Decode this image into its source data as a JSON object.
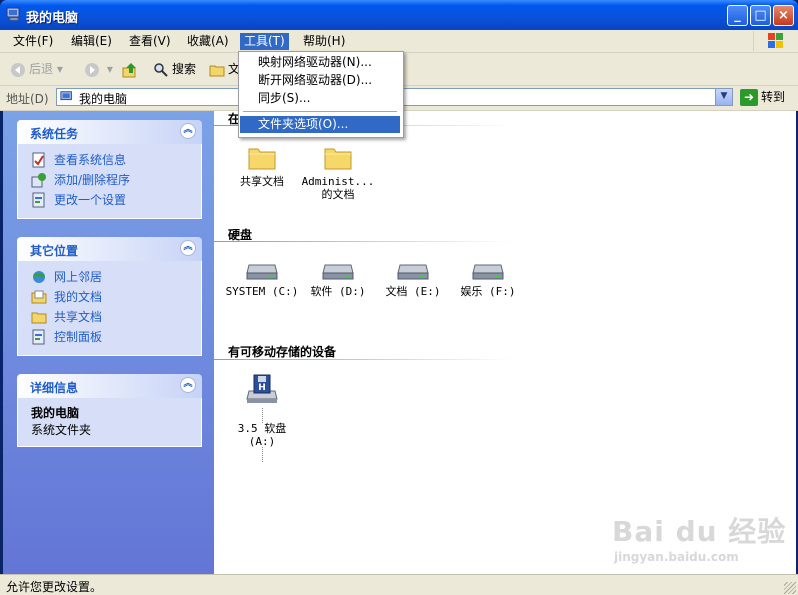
{
  "window": {
    "title": "我的电脑"
  },
  "menubar": {
    "items": [
      "文件(F)",
      "编辑(E)",
      "查看(V)",
      "收藏(A)",
      "工具(T)",
      "帮助(H)"
    ]
  },
  "toolbar": {
    "back_label": "后退",
    "search_label": "搜索",
    "folders_label": "文"
  },
  "address": {
    "label": "地址(D)",
    "value": "我的电脑",
    "go_label": "转到"
  },
  "tasks": {
    "title": "系统任务",
    "items": [
      "查看系统信息",
      "添加/删除程序",
      "更改一个设置"
    ]
  },
  "places": {
    "title": "其它位置",
    "items": [
      "网上邻居",
      "我的文档",
      "共享文档",
      "控制面板"
    ]
  },
  "details": {
    "title": "详细信息",
    "name": "我的电脑",
    "subtitle": "系统文件夹"
  },
  "groups": {
    "files_partial": "在",
    "drives": "硬盘",
    "removable": "有可移动存储的设备"
  },
  "folders": [
    {
      "label1": "共享文档",
      "label2": ""
    },
    {
      "label1": "Administ...",
      "label2": "的文档"
    }
  ],
  "drives": [
    "SYSTEM (C:)",
    "软件 (D:)",
    "文档 (E:)",
    "娱乐 (F:)"
  ],
  "removable": [
    {
      "label1": "3.5 软盘",
      "label2": "(A:)"
    }
  ],
  "tools_menu": {
    "items": [
      "映射网络驱动器(N)...",
      "断开网络驱动器(D)...",
      "同步(S)...",
      "文件夹选项(O)..."
    ]
  },
  "status": {
    "text": "允许您更改设置。"
  },
  "watermark": {
    "main": "Bai du 经验",
    "sub": "jingyan.baidu.com"
  },
  "colors": {
    "titlebar": "#0a52d8",
    "link": "#215dc6",
    "menu_highlight": "#316ac5",
    "leftpane": "#6375d6"
  }
}
